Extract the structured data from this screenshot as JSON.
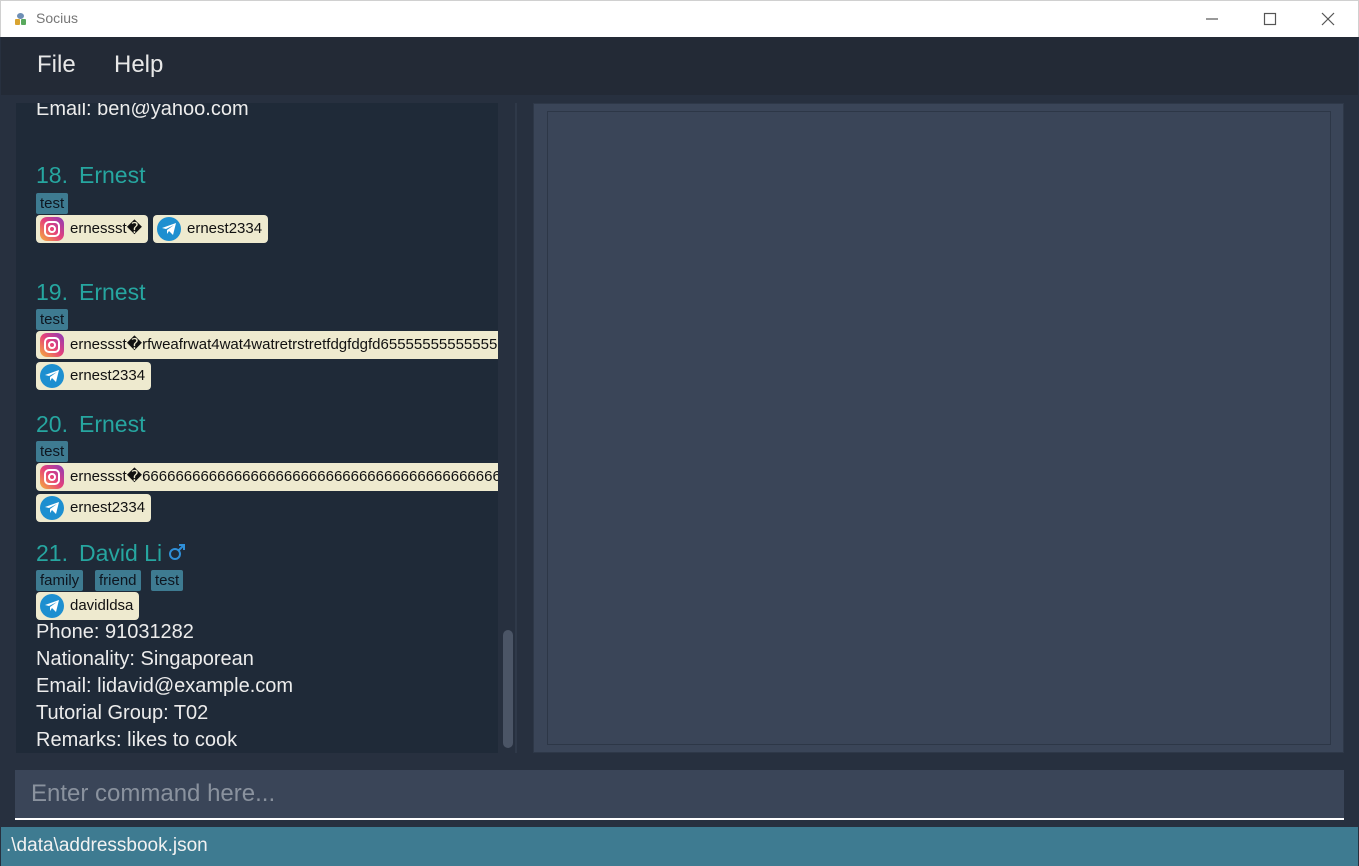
{
  "window": {
    "title": "Socius",
    "icon": "socius-app-icon",
    "controls": [
      "minimize-icon",
      "maximize-icon",
      "close-icon"
    ]
  },
  "menu": {
    "file_label": "File",
    "help_label": "Help"
  },
  "person_list": {
    "partial_top_email": "Email: ben@yahoo.com",
    "persons": [
      {
        "index": "18.",
        "name": "Ernest",
        "tags": [
          "test"
        ],
        "socials": [
          {
            "type": "instagram",
            "icon": "instagram-icon",
            "handle": "ernessst�"
          },
          {
            "type": "telegram",
            "icon": "telegram-icon",
            "handle": "ernest2334"
          }
        ]
      },
      {
        "index": "19.",
        "name": "Ernest",
        "tags": [
          "test"
        ],
        "socials": [
          {
            "type": "instagram",
            "icon": "instagram-icon",
            "handle": "ernessst�rfweafrwat4wat4watretrstretfdgfdgfd65555555555555"
          },
          {
            "type": "telegram",
            "icon": "telegram-icon",
            "handle": "ernest2334"
          }
        ]
      },
      {
        "index": "20.",
        "name": "Ernest",
        "tags": [
          "test"
        ],
        "socials": [
          {
            "type": "instagram",
            "icon": "instagram-icon",
            "handle": "ernessst�666666666666666666666666666666666666666666666666666666"
          },
          {
            "type": "telegram",
            "icon": "telegram-icon",
            "handle": "ernest2334"
          }
        ]
      },
      {
        "index": "21.",
        "name": "David Li",
        "gender_icon": "male-gender-icon",
        "tags": [
          "family",
          "friend",
          "test"
        ],
        "socials": [
          {
            "type": "telegram",
            "icon": "telegram-icon",
            "handle": "davidldsa"
          }
        ],
        "details": {
          "phone": "Phone: 91031282",
          "nationality": "Nationality: Singaporean",
          "email": "Email: lidavid@example.com",
          "tutorial_group": "Tutorial Group: T02",
          "remarks": "Remarks: likes to cook"
        }
      }
    ]
  },
  "command": {
    "placeholder": "Enter command here...",
    "value": ""
  },
  "status": {
    "file_path": ".\\data\\addressbook.json"
  },
  "colors": {
    "name_accent": "#26a6a0",
    "tag_bg": "#3e7b91",
    "social_bg": "#eeeacf",
    "status_bar": "#3e7b91",
    "panel_bg": "#1f2a38"
  }
}
